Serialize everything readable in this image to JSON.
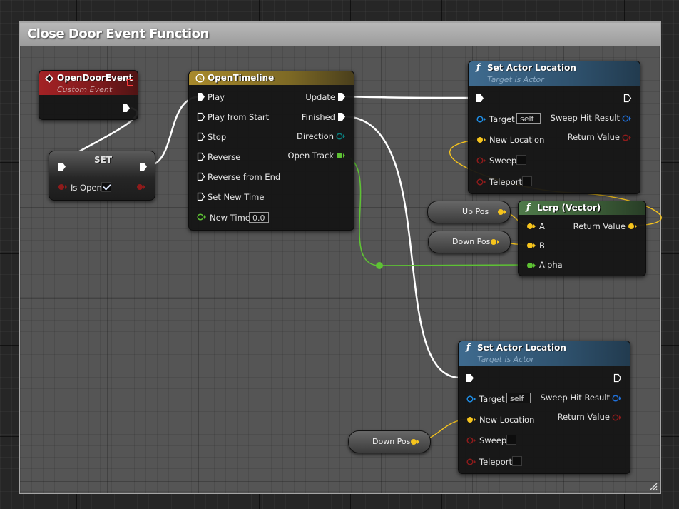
{
  "comment": {
    "title": "Close Door Event Function",
    "color": "#a8a8a8"
  },
  "colors": {
    "exec_wire": "#ffffff",
    "float_pin": "#5ec234",
    "vector_pin": "#f6c41d",
    "object_pin": "#1f8fe8",
    "bool_pin": "#8f1b1b",
    "event_header": "#a32225",
    "timeline_header": "#a88a2c",
    "function_header": "#3f6b8f",
    "pure_header": "#4f7a4a"
  },
  "nodes": {
    "open_door_event": {
      "title": "OpenDoorEvent",
      "subtitle": "Custom Event",
      "icon": "event-diamond-icon"
    },
    "set_node": {
      "title": "SET",
      "var_label": "Is Open",
      "checked": true
    },
    "open_timeline": {
      "title": "OpenTimeline",
      "icon": "clock-icon",
      "inputs": [
        "Play",
        "Play from Start",
        "Stop",
        "Reverse",
        "Reverse from End",
        "Set New Time"
      ],
      "new_time_label": "New Time",
      "new_time_value": "0.0",
      "outputs": {
        "update": "Update",
        "finished": "Finished",
        "direction": "Direction",
        "open_track": "Open Track"
      }
    },
    "set_actor_location_top": {
      "title": "Set Actor Location",
      "subtitle": "Target is Actor",
      "target_label": "Target",
      "target_value": "self",
      "new_location_label": "New Location",
      "sweep_label": "Sweep",
      "teleport_label": "Teleport",
      "sweep_hit_result_label": "Sweep Hit Result",
      "return_value_label": "Return Value"
    },
    "lerp_vector": {
      "title": "Lerp (Vector)",
      "a_label": "A",
      "b_label": "B",
      "alpha_label": "Alpha",
      "return_value_label": "Return Value"
    },
    "up_pos": {
      "label": "Up Pos"
    },
    "down_pos_1": {
      "label": "Down Pos"
    },
    "set_actor_location_bottom": {
      "title": "Set Actor Location",
      "subtitle": "Target is Actor",
      "target_label": "Target",
      "target_value": "self",
      "new_location_label": "New Location",
      "sweep_label": "Sweep",
      "teleport_label": "Teleport",
      "sweep_hit_result_label": "Sweep Hit Result",
      "return_value_label": "Return Value"
    },
    "down_pos_2": {
      "label": "Down Pos"
    }
  }
}
